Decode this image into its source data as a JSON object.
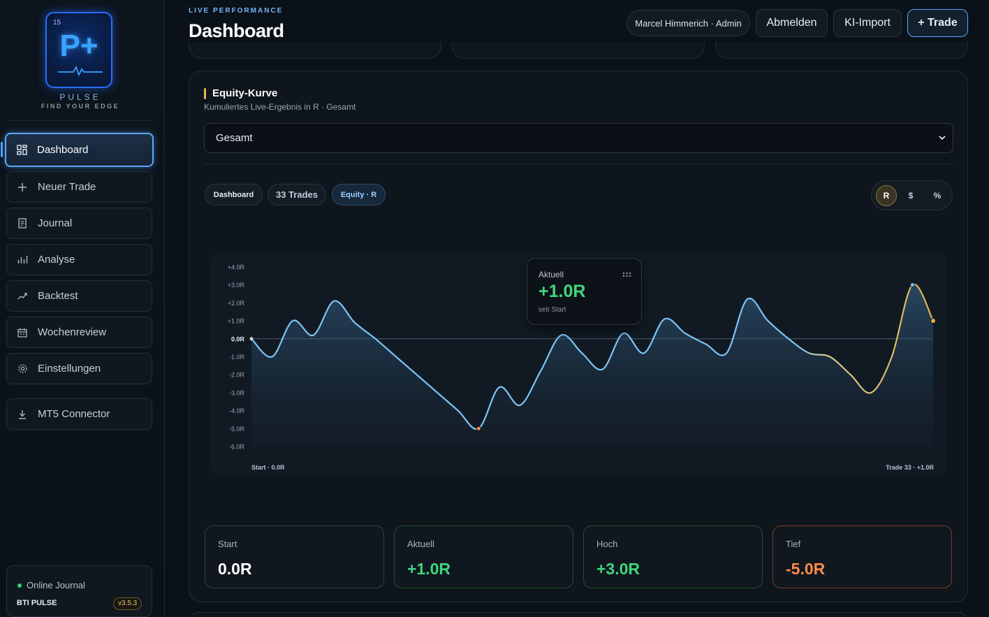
{
  "brand": {
    "badge_number": "15",
    "logo_mark": "P+",
    "name": "PULSE",
    "tagline": "FIND YOUR EDGE"
  },
  "sidebar": {
    "items": [
      {
        "label": "Dashboard",
        "icon": "dashboard-grid-icon",
        "active": true
      },
      {
        "label": "Neuer Trade",
        "icon": "plus-icon"
      },
      {
        "label": "Journal",
        "icon": "document-icon"
      },
      {
        "label": "Analyse",
        "icon": "bar-chart-icon"
      },
      {
        "label": "Backtest",
        "icon": "trend-up-icon"
      },
      {
        "label": "Wochenreview",
        "icon": "calendar-icon"
      },
      {
        "label": "Einstellungen",
        "icon": "gear-icon"
      },
      {
        "label": "MT5 Connector",
        "icon": "download-icon"
      }
    ],
    "footer": {
      "status": "Online Journal",
      "product": "BTI PULSE",
      "version": "v3.5.3"
    }
  },
  "header": {
    "kicker": "LIVE PERFORMANCE",
    "title": "Dashboard",
    "user": "Marcel Himmerich · Admin",
    "logout": "Abmelden",
    "import": "KI-Import",
    "new_trade": "+ Trade"
  },
  "card": {
    "title": "Equity-Kurve",
    "subtitle": "Kumuliertes Live-Ergebnis in R · Gesamt",
    "filter_value": "Gesamt",
    "pills": [
      "Dashboard",
      "33 Trades",
      "Equity · R"
    ],
    "units": [
      "R",
      "$",
      "%"
    ],
    "selected_unit": "R"
  },
  "tooltip": {
    "label": "Aktuell",
    "value": "+1.0R",
    "sub": "seit Start"
  },
  "stats": [
    {
      "label": "Start",
      "value": "0.0R",
      "color": "#ffffff"
    },
    {
      "label": "Aktuell",
      "value": "+1.0R",
      "color": "#3fd67e"
    },
    {
      "label": "Hoch",
      "value": "+3.0R",
      "color": "#3fd67e"
    },
    {
      "label": "Tief",
      "value": "-5.0R",
      "color": "#ff8a4a"
    }
  ],
  "chart_data": {
    "type": "line",
    "ylabel_ticks": [
      "+4.0R",
      "+3.0R",
      "+2.0R",
      "+1.0R",
      "0.0R",
      "-1.0R",
      "-2.0R",
      "-3.0R",
      "-4.0R",
      "-5.0R",
      "-6.0R"
    ],
    "ylim": [
      -6,
      4
    ],
    "x_start_label": "Start · 0.0R",
    "x_end_label": "Trade 33 · +1.0R",
    "x": [
      0,
      1,
      2,
      3,
      4,
      5,
      6,
      7,
      8,
      9,
      10,
      11,
      12,
      13,
      14,
      15,
      16,
      17,
      18,
      19,
      20,
      21,
      22,
      23,
      24,
      25,
      26,
      27,
      28,
      29,
      30,
      31,
      32,
      33
    ],
    "values": [
      0,
      -1.0,
      1.0,
      0.2,
      2.1,
      0.9,
      0,
      -1.0,
      -2.0,
      -3.0,
      -4.0,
      -5.0,
      -2.7,
      -3.7,
      -1.8,
      0.2,
      -0.8,
      -1.7,
      0.3,
      -0.8,
      1.1,
      0.3,
      -0.3,
      -0.8,
      2.2,
      1.0,
      0,
      -0.8,
      -1.0,
      -2.0,
      -3.0,
      -1.0,
      3.0,
      1.0
    ],
    "line_color": "#7cc4f5",
    "marker_low_color": "#ff8a4a",
    "marker_end_color": "#e0b24a"
  }
}
